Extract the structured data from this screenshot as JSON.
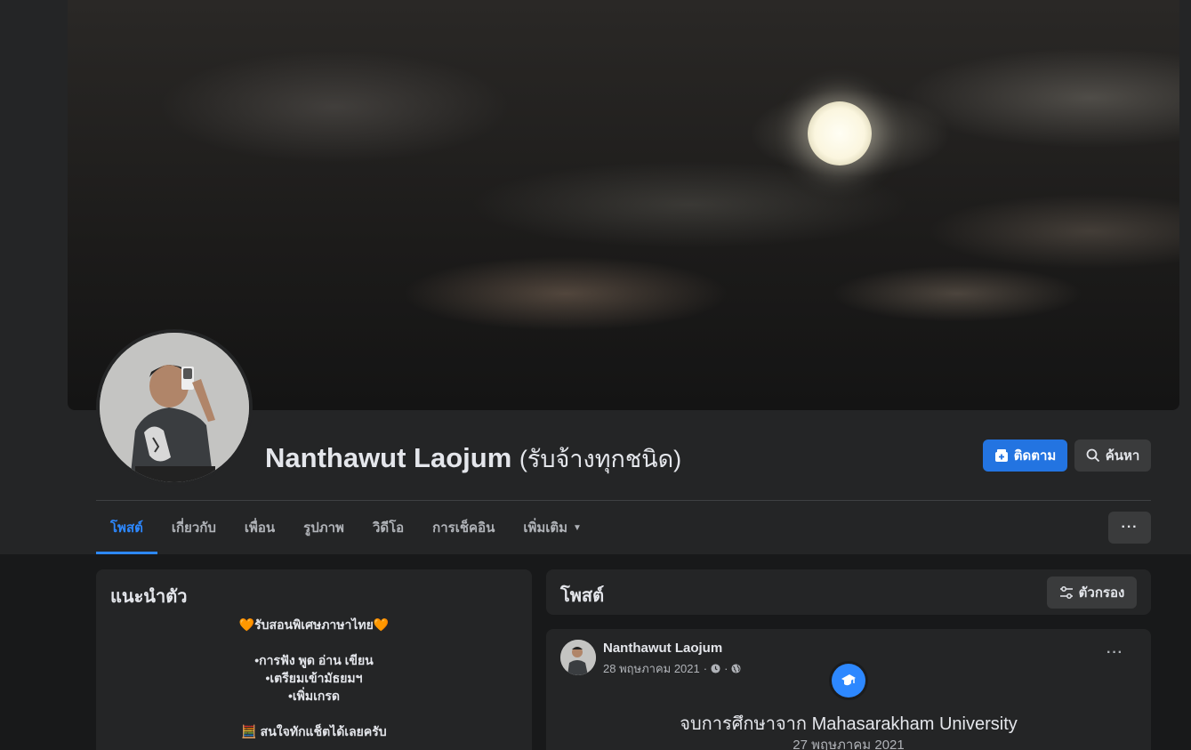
{
  "profile": {
    "name": "Nanthawut Laojum",
    "name_suffix": "(รับจ้างทุกชนิด)"
  },
  "actions": {
    "follow_label": "ติดตาม",
    "search_label": "ค้นหา",
    "more_label": "···"
  },
  "tabs": [
    {
      "label": "โพสต์",
      "active": true
    },
    {
      "label": "เกี่ยวกับ"
    },
    {
      "label": "เพื่อน"
    },
    {
      "label": "รูปภาพ"
    },
    {
      "label": "วิดีโอ"
    },
    {
      "label": "การเช็คอิน"
    },
    {
      "label": "เพิ่มเติม"
    }
  ],
  "intro": {
    "title": "แนะนำตัว",
    "lines": [
      "🧡รับสอนพิเศษภาษาไทย🧡",
      "",
      "•การฟัง พูด อ่าน เขียน",
      "•เตรียมเข้ามัธยมฯ",
      "•เพิ่มเกรด",
      "",
      "🧮 สนใจทักแช็ตได้เลยครับ"
    ]
  },
  "posts_header": {
    "title": "โพสต์",
    "filter_label": "ตัวกรอง"
  },
  "post": {
    "author": "Nanthawut Laojum",
    "date": "28 พฤษภาคม 2021",
    "meta_sep": "·",
    "more_label": "···",
    "event_title": "จบการศึกษาจาก Mahasarakham University",
    "event_date": "27 พฤษภาคม 2021"
  },
  "colors": {
    "accent": "#2374e1",
    "tab_active": "#2d88ff",
    "surface": "#242526",
    "background": "#18191a"
  }
}
